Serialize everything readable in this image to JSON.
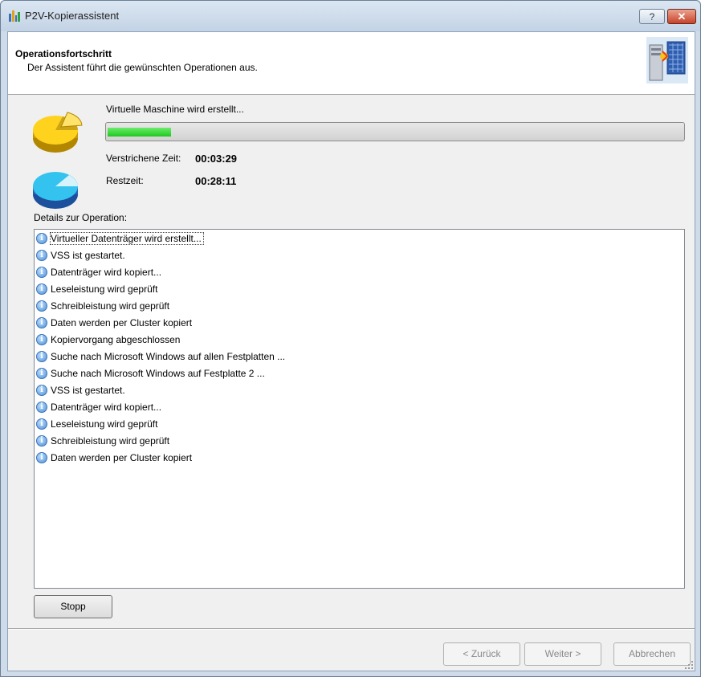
{
  "window": {
    "title": "P2V-Kopierassistent",
    "help_glyph": "?",
    "close_glyph": "✕"
  },
  "header": {
    "title": "Operationsfortschritt",
    "subtitle": "Der Assistent führt die gewünschten Operationen aus."
  },
  "progress": {
    "status_text": "Virtuelle Maschine wird erstellt...",
    "fraction": 0.11,
    "elapsed_label": "Verstrichene Zeit:",
    "elapsed_value": "00:03:29",
    "remaining_label": "Restzeit:",
    "remaining_value": "00:28:11",
    "fill_color": "#1ec81e"
  },
  "details": {
    "label": "Details zur Operation:",
    "entries": [
      "Virtueller Datenträger wird erstellt...",
      "VSS ist gestartet.",
      "Datenträger wird kopiert...",
      "Leseleistung wird geprüft",
      "Schreibleistung wird geprüft",
      "Daten werden per Cluster kopiert",
      "Kopiervorgang abgeschlossen",
      "Suche nach Microsoft Windows auf allen Festplatten ...",
      "Suche nach Microsoft Windows auf Festplatte 2 ...",
      "VSS ist gestartet.",
      "Datenträger wird kopiert...",
      "Leseleistung wird geprüft",
      "Schreibleistung wird geprüft",
      "Daten werden per Cluster kopiert"
    ]
  },
  "buttons": {
    "stop": "Stopp",
    "back": "< Zurück",
    "next": "Weiter >",
    "cancel": "Abbrechen"
  },
  "icons": {
    "app": "p2v-app-icon",
    "header": "server-wizard-icon",
    "pie_top": "yellow-pie-icon",
    "pie_bottom": "cyan-pie-icon",
    "log_entry": "info-icon"
  }
}
